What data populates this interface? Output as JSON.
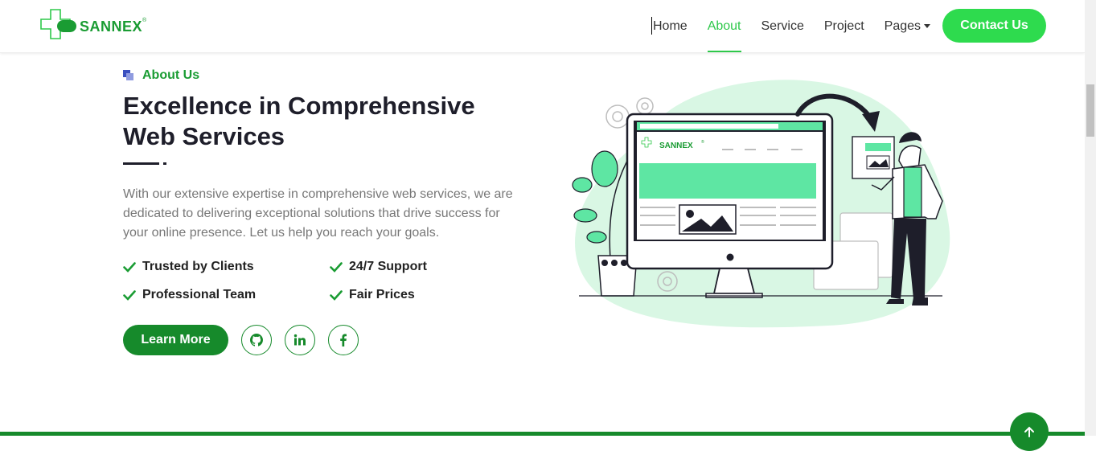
{
  "brand": {
    "name": "SANNEX",
    "reg_mark": "®"
  },
  "nav": {
    "items": [
      {
        "label": "Home",
        "active": false
      },
      {
        "label": "About",
        "active": true
      },
      {
        "label": "Service",
        "active": false
      },
      {
        "label": "Project",
        "active": false
      },
      {
        "label": "Pages",
        "active": false,
        "dropdown": true
      }
    ],
    "cta_label": "Contact Us"
  },
  "about": {
    "eyebrow": "About Us",
    "headline_line1": "Excellence in Comprehensive",
    "headline_line2": "Web Services",
    "description": "With our extensive expertise in comprehensive web services, we are dedicated to delivering exceptional solutions that drive success for your online presence. Let us help you reach your goals.",
    "features": [
      "Trusted by Clients",
      "24/7 Support",
      "Professional Team",
      "Fair Prices"
    ],
    "learn_more_label": "Learn More",
    "social": [
      "github-icon",
      "linkedin-icon",
      "facebook-icon"
    ]
  },
  "illustration": {
    "monitor_brand": "SANNEX",
    "monitor_reg_mark": "®"
  },
  "colors": {
    "brand_green": "#1a9c33",
    "accent_green": "#2edb4e",
    "dark_green": "#168a2b",
    "mint": "#d9f7e4",
    "screen_green": "#5ee6a3",
    "text_dark": "#1e1e2a",
    "text_muted": "#777777"
  }
}
